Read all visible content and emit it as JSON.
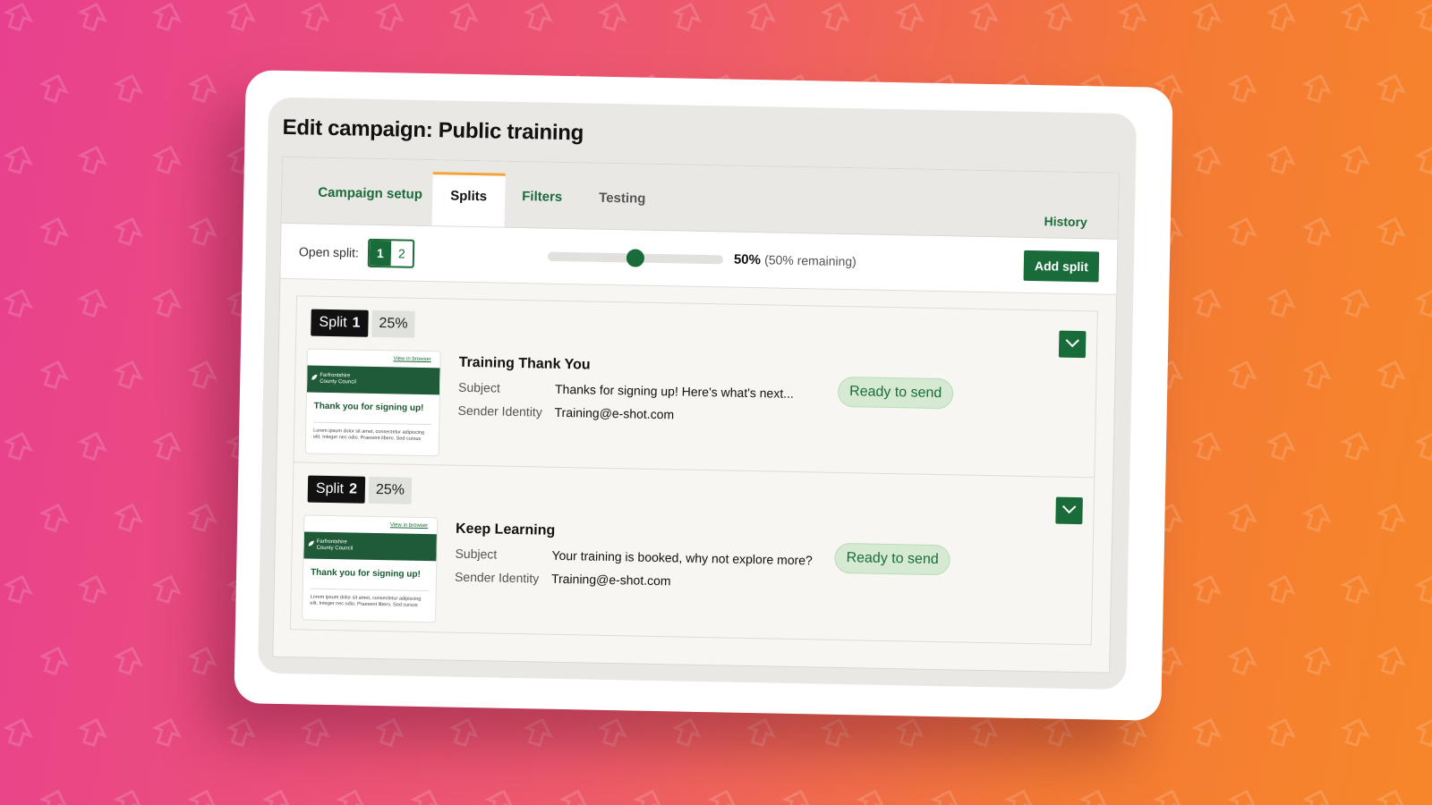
{
  "page": {
    "title": "Edit campaign: Public training"
  },
  "tabs": [
    {
      "label": "Campaign setup",
      "state": "inactive"
    },
    {
      "label": "Splits",
      "state": "active"
    },
    {
      "label": "Filters",
      "state": "inactive"
    },
    {
      "label": "Testing",
      "state": "muted"
    }
  ],
  "history_label": "History",
  "toolbar": {
    "open_split_label": "Open split:",
    "split_options": [
      "1",
      "2"
    ],
    "selected_split": "1",
    "slider_value": 0.5,
    "percent_label": "50%",
    "remaining_label": "(50% remaining)",
    "add_split_label": "Add split"
  },
  "splits": [
    {
      "name": "Split",
      "number": "1",
      "percent": "25%",
      "email_title": "Training Thank You",
      "subject_label": "Subject",
      "subject": "Thanks for signing up! Here's what's next...",
      "sender_label": "Sender Identity",
      "sender": "Training@e-shot.com",
      "status": "Ready to send",
      "thumb": {
        "view_link": "View in browser",
        "org_line1": "Farfrontshire",
        "org_line2": "County Council",
        "heading": "Thank you for signing up!",
        "body": "Lorem ipsum dolor sit amet, consectetur adipiscing elit. Integer nec odio. Praesent libero. Sed cursus"
      }
    },
    {
      "name": "Split",
      "number": "2",
      "percent": "25%",
      "email_title": "Keep Learning",
      "subject_label": "Subject",
      "subject": "Your training is booked, why not explore more?",
      "sender_label": "Sender Identity",
      "sender": "Training@e-shot.com",
      "status": "Ready to send",
      "thumb": {
        "view_link": "View in browser",
        "org_line1": "Farfrontshire",
        "org_line2": "County Council",
        "heading": "Thank you for signing up!",
        "body": "Lorem ipsum dolor sit amet, consectetur adipiscing elit. Integer nec odio. Praesent libero. Sed cursus"
      }
    }
  ],
  "colors": {
    "brand_green": "#1a6b3a",
    "tab_accent": "#f0a43a",
    "status_bg": "#d6ead3",
    "bg_gradient_start": "#e8408f",
    "bg_gradient_end": "#f7862a"
  },
  "icons": {
    "background": "arrow-up-icon",
    "expand": "chevron-down-icon"
  }
}
